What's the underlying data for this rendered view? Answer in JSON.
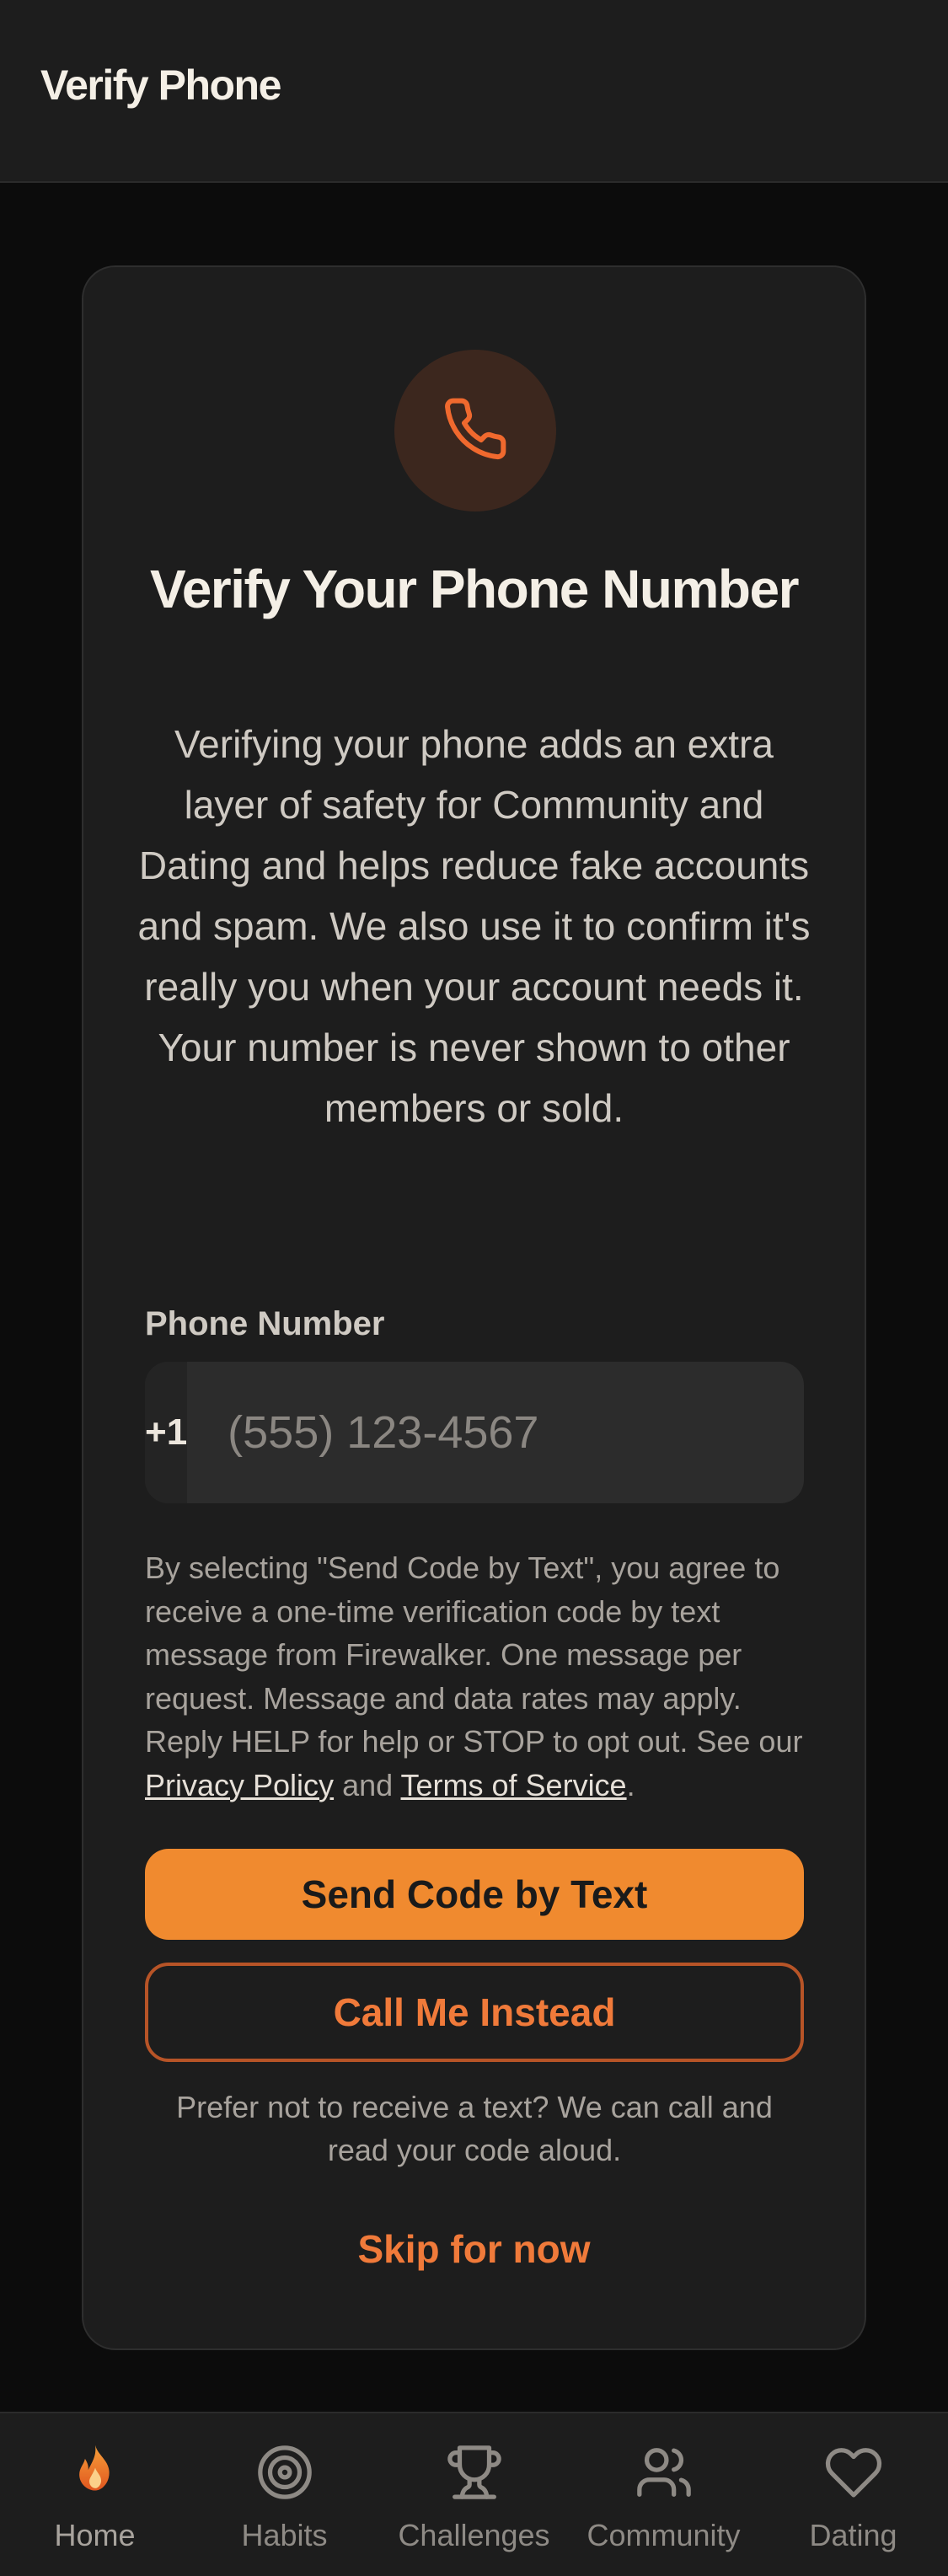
{
  "header": {
    "title": "Verify Phone"
  },
  "card": {
    "icon": "phone-icon",
    "title": "Verify Your Phone Number",
    "description": "Verifying your phone adds an extra layer of safety for Community and Dating and helps reduce fake accounts and spam. We also use it to confirm it's really you when your account needs it. Your number is never shown to other members or sold."
  },
  "phone_field": {
    "label": "Phone Number",
    "country_code": "+1",
    "placeholder": "(555) 123-4567",
    "value": ""
  },
  "consent": {
    "text": "By selecting \"Send Code by Text\", you agree to receive a one-time verification code by text message from Firewalker. One message per request. Message and data rates may apply. Reply HELP for help or STOP to opt out. See our",
    "privacy_link": "Privacy Policy",
    "and": "and",
    "terms_link": "Terms of Service",
    "end": "."
  },
  "actions": {
    "send_code_label": "Send Code by Text",
    "call_label": "Call Me Instead",
    "call_note": "Prefer not to receive a text? We can call and read your code aloud.",
    "skip_label": "Skip for now"
  },
  "nav": {
    "items": [
      {
        "label": "Home",
        "icon": "flame-icon",
        "active": true
      },
      {
        "label": "Habits",
        "icon": "target-icon",
        "active": false
      },
      {
        "label": "Challenges",
        "icon": "trophy-icon",
        "active": false
      },
      {
        "label": "Community",
        "icon": "users-icon",
        "active": false
      },
      {
        "label": "Dating",
        "icon": "heart-icon",
        "active": false
      }
    ]
  },
  "colors": {
    "accent": "#f08a2f",
    "accent_text": "#f07a3a",
    "background": "#0c0c0c",
    "surface": "#1d1d1d"
  }
}
